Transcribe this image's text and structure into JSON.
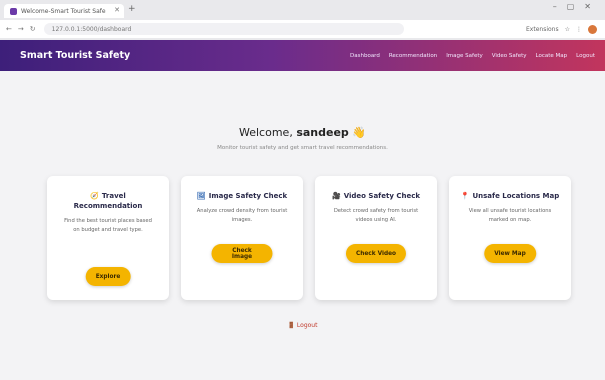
{
  "browser": {
    "tab_title": "Welcome-Smart Tourist Safe",
    "url": "127.0.0.1:5000/dashboard",
    "toolbar_text": "Extensions"
  },
  "app": {
    "brand": "Smart Tourist Safety",
    "nav": [
      "Dashboard",
      "Recommendation",
      "Image Safety",
      "Video Safety",
      "Locate Map",
      "Logout"
    ]
  },
  "welcome": {
    "prefix": "Welcome, ",
    "username": "sandeep",
    "emoji": "👋",
    "subtitle": "Monitor tourist safety and get smart travel recommendations."
  },
  "cards": [
    {
      "icon": "🧭",
      "title": "Travel Recommendation",
      "desc": "Find the best tourist places based on budget and travel type.",
      "button": "Explore"
    },
    {
      "icon": "🖼",
      "title": "Image Safety Check",
      "desc": "Analyze crowd density from tourist images.",
      "button": "Check Image"
    },
    {
      "icon": "🎥",
      "title": "Video Safety Check",
      "desc": "Detect crowd safety from tourist videos using AI.",
      "button": "Check Video"
    },
    {
      "icon": "📍",
      "title": "Unsafe Locations Map",
      "desc": "View all unsafe tourist locations marked on map.",
      "button": "View Map"
    }
  ],
  "logout_label": "Logout",
  "colors": {
    "accent": "#f4b400",
    "nav_start": "#3d1f7a",
    "nav_end": "#c2355d"
  }
}
